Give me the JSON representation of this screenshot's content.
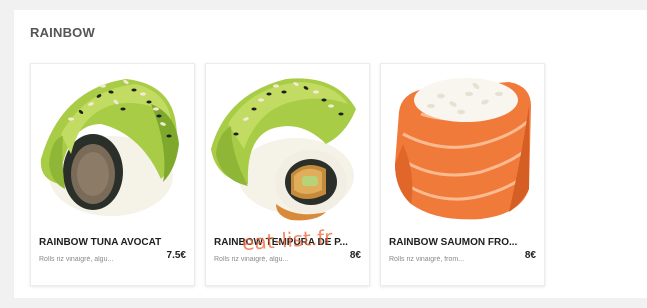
{
  "section": {
    "title": "RAINBOW"
  },
  "products": [
    {
      "name": "RAINBOW TUNA AVOCAT",
      "description": "Rolls riz vinaigré, algu...",
      "price": "7.5€",
      "image_icon": "rainbow-tuna-avocado-roll-image"
    },
    {
      "name": "RAINBOW TEMPURA DE P...",
      "description": "Rolls riz vinaigré, algu...",
      "price": "8€",
      "image_icon": "rainbow-tempura-roll-image"
    },
    {
      "name": "RAINBOW SAUMON FRO...",
      "description": "Rolls riz vinaigré, from...",
      "price": "8€",
      "image_icon": "rainbow-salmon-cheese-roll-image"
    }
  ],
  "watermark": "eat-list.fr",
  "colors": {
    "avocado": "#9cc43a",
    "salmon": "#f07a3a",
    "rice": "#f5f2e8",
    "nori": "#2b2f2a"
  }
}
